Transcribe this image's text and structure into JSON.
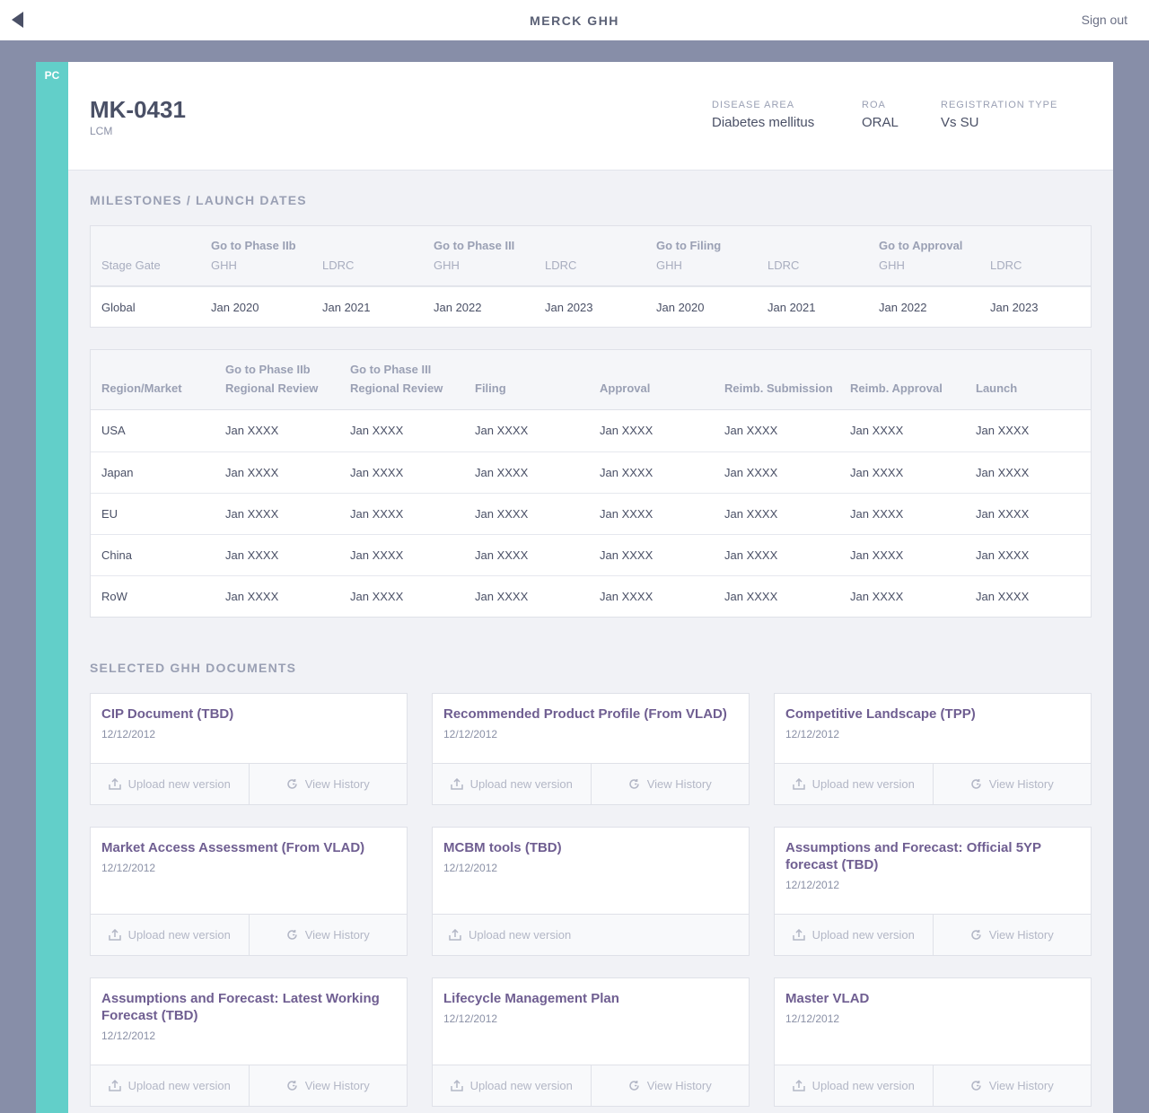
{
  "topbar": {
    "title": "MERCK GHH",
    "sign_out": "Sign out"
  },
  "sidebar": {
    "tag": "PC"
  },
  "product": {
    "id": "MK-0431",
    "type": "LCM",
    "meta": [
      {
        "label": "DISEASE AREA",
        "value": "Diabetes mellitus"
      },
      {
        "label": "ROA",
        "value": "ORAL"
      },
      {
        "label": "REGISTRATION TYPE",
        "value": "Vs SU"
      }
    ]
  },
  "milestones": {
    "section_title": "MILESTONES / LAUNCH DATES",
    "stage_gate_label": "Stage Gate",
    "groups": [
      "Go to Phase IIb",
      "Go to Phase III",
      "Go to Filing",
      "Go to Approval"
    ],
    "sub_labels": [
      "GHH",
      "LDRC",
      "GHH",
      "LDRC",
      "GHH",
      "LDRC",
      "GHH",
      "LDRC"
    ],
    "row": {
      "label": "Global",
      "values": [
        "Jan 2020",
        "Jan 2021",
        "Jan 2022",
        "Jan 2023",
        "Jan 2020",
        "Jan 2021",
        "Jan 2022",
        "Jan 2023"
      ]
    }
  },
  "regional": {
    "headers": [
      {
        "line1": "",
        "line2": "Region/Market"
      },
      {
        "line1": "Go to Phase IIb",
        "line2": "Regional Review"
      },
      {
        "line1": "Go to Phase III",
        "line2": "Regional Review"
      },
      {
        "line1": "",
        "line2": "Filing"
      },
      {
        "line1": "",
        "line2": "Approval"
      },
      {
        "line1": "",
        "line2": "Reimb. Submission"
      },
      {
        "line1": "",
        "line2": "Reimb. Approval"
      },
      {
        "line1": "",
        "line2": "Launch"
      }
    ],
    "rows": [
      {
        "region": "USA",
        "values": [
          "Jan XXXX",
          "Jan XXXX",
          "Jan XXXX",
          "Jan XXXX",
          "Jan XXXX",
          "Jan XXXX",
          "Jan XXXX"
        ]
      },
      {
        "region": "Japan",
        "values": [
          "Jan XXXX",
          "Jan XXXX",
          "Jan XXXX",
          "Jan XXXX",
          "Jan XXXX",
          "Jan XXXX",
          "Jan XXXX"
        ]
      },
      {
        "region": "EU",
        "values": [
          "Jan XXXX",
          "Jan XXXX",
          "Jan XXXX",
          "Jan XXXX",
          "Jan XXXX",
          "Jan XXXX",
          "Jan XXXX"
        ]
      },
      {
        "region": "China",
        "values": [
          "Jan XXXX",
          "Jan XXXX",
          "Jan XXXX",
          "Jan XXXX",
          "Jan XXXX",
          "Jan XXXX",
          "Jan XXXX"
        ]
      },
      {
        "region": "RoW",
        "values": [
          "Jan XXXX",
          "Jan XXXX",
          "Jan XXXX",
          "Jan XXXX",
          "Jan XXXX",
          "Jan XXXX",
          "Jan XXXX"
        ]
      }
    ]
  },
  "documents": {
    "section_title": "SELECTED GHH DOCUMENTS",
    "upload_label": "Upload new version",
    "history_label": "View History",
    "items": [
      {
        "title": "CIP Document (TBD)",
        "date": "12/12/2012",
        "has_history": true
      },
      {
        "title": "Recommended Product Profile (From VLAD)",
        "date": "12/12/2012",
        "has_history": true
      },
      {
        "title": "Competitive Landscape (TPP)",
        "date": "12/12/2012",
        "has_history": true
      },
      {
        "title": "Market Access Assessment (From VLAD)",
        "date": "12/12/2012",
        "has_history": true
      },
      {
        "title": "MCBM tools (TBD)",
        "date": "12/12/2012",
        "has_history": false
      },
      {
        "title": "Assumptions and Forecast: Official 5YP forecast (TBD)",
        "date": "12/12/2012",
        "has_history": true
      },
      {
        "title": "Assumptions and Forecast: Latest Working Forecast (TBD)",
        "date": "12/12/2012",
        "has_history": true
      },
      {
        "title": "Lifecycle Management Plan",
        "date": "12/12/2012",
        "has_history": true
      },
      {
        "title": "Master VLAD",
        "date": "12/12/2012",
        "has_history": true
      }
    ]
  }
}
